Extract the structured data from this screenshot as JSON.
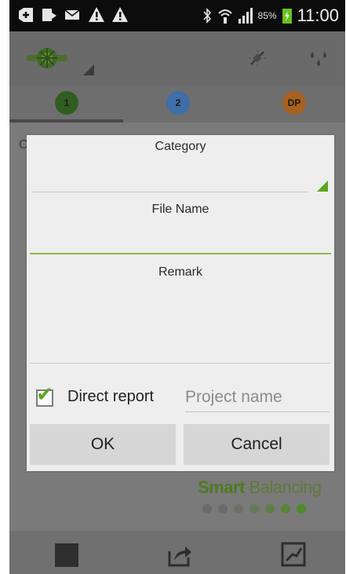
{
  "status_bar": {
    "battery_percent": "85%",
    "time": "11:00",
    "icons": [
      "add-icon",
      "usb-icon",
      "mail-icon",
      "warning-icon",
      "warning-icon",
      "bluetooth-icon",
      "wifi-icon",
      "signal-icon",
      "battery-icon"
    ]
  },
  "action_bar": {
    "icons": [
      "valve-logo-icon",
      "spinner-arrow-icon",
      "plug-icon",
      "drops-icon"
    ]
  },
  "tabs": [
    {
      "label": "1",
      "color": "#3b7a2a"
    },
    {
      "label": "2",
      "color": "#4a7fc4"
    },
    {
      "label": "DP",
      "color": "#c8742a"
    }
  ],
  "dialog": {
    "category_label": "Category",
    "file_name_label": "File Name",
    "remark_label": "Remark",
    "direct_report_label": "Direct report",
    "direct_report_checked": true,
    "project_name_placeholder": "Project name",
    "ok_label": "OK",
    "cancel_label": "Cancel"
  },
  "background": {
    "brand_bold": "Smart",
    "brand_regular": " Balancing",
    "background_letter": "C"
  },
  "bottom_bar": {
    "icons": [
      "stop-icon",
      "share-icon",
      "graph-icon"
    ]
  },
  "colors": {
    "accent_green": "#5ca61e",
    "dialog_bg": "#eeeeee",
    "button_bg": "#d6d6d6"
  }
}
